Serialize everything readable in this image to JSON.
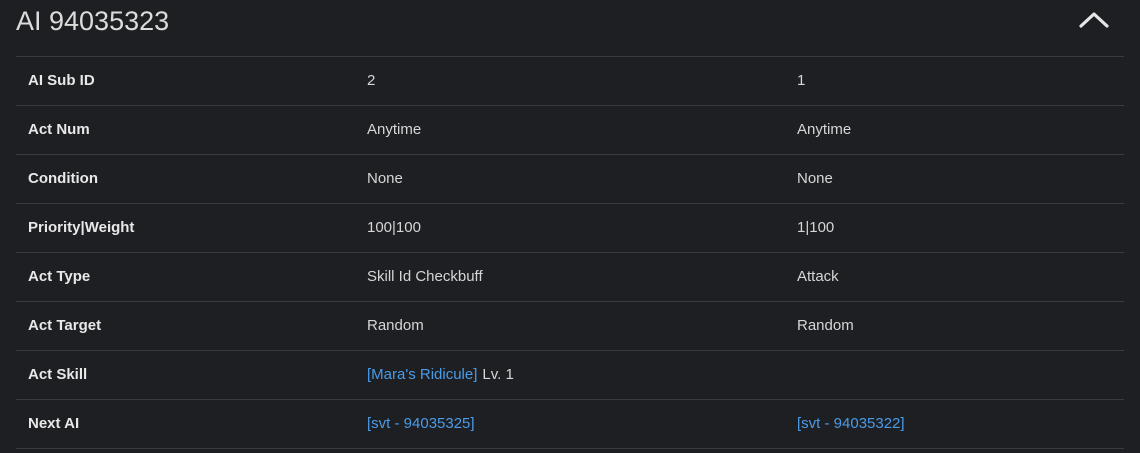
{
  "header": {
    "title": "AI 94035323",
    "collapse_icon": "chevron-up-icon"
  },
  "colors": {
    "background": "#1e1f22",
    "link": "#4a9be8",
    "divider": "#3a3b3e"
  },
  "rows": [
    {
      "label": "AI Sub ID",
      "col1": "2",
      "col2": "1"
    },
    {
      "label": "Act Num",
      "col1": "Anytime",
      "col2": "Anytime"
    },
    {
      "label": "Condition",
      "col1": "None",
      "col2": "None"
    },
    {
      "label": "Priority|Weight",
      "col1": "100|100",
      "col2": "1|100"
    },
    {
      "label": "Act Type",
      "col1": "Skill Id Checkbuff",
      "col2": "Attack"
    },
    {
      "label": "Act Target",
      "col1": "Random",
      "col2": "Random"
    },
    {
      "label": "Act Skill",
      "col1_link": "[Mara's Ridicule]",
      "col1_suffix": "Lv. 1",
      "col2": ""
    },
    {
      "label": "Next AI",
      "col1_link": "[svt - 94035325]",
      "col2_link": "[svt - 94035322]"
    }
  ]
}
